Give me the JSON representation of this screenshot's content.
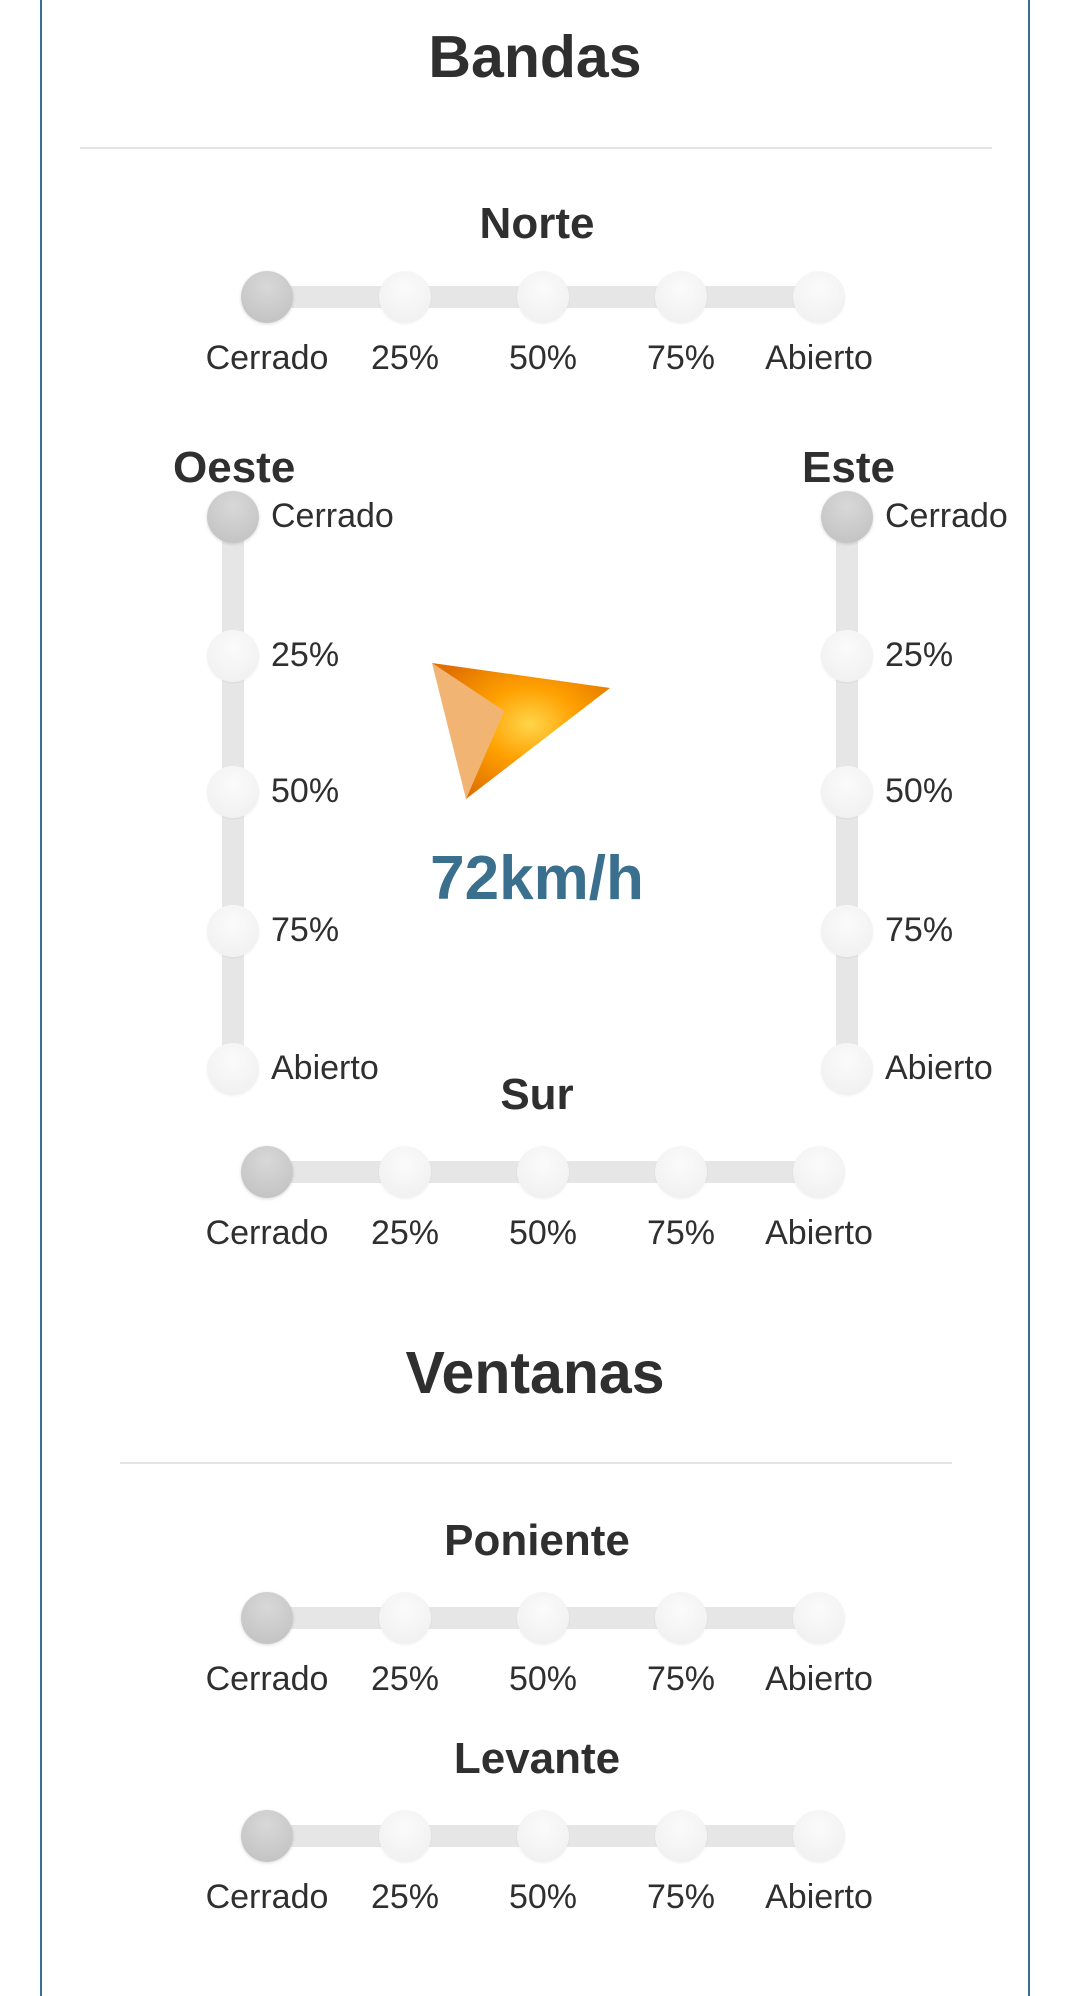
{
  "bandas": {
    "title": "Bandas",
    "norte": {
      "label": "Norte",
      "options": [
        "Cerrado",
        "25%",
        "50%",
        "75%",
        "Abierto"
      ],
      "selected": "Cerrado"
    },
    "oeste": {
      "label": "Oeste",
      "options": [
        "Cerrado",
        "25%",
        "50%",
        "75%",
        "Abierto"
      ],
      "selected": "Cerrado"
    },
    "este": {
      "label": "Este",
      "options": [
        "Cerrado",
        "25%",
        "50%",
        "75%",
        "Abierto"
      ],
      "selected": "Cerrado"
    },
    "sur": {
      "label": "Sur",
      "options": [
        "Cerrado",
        "25%",
        "50%",
        "75%",
        "Abierto"
      ],
      "selected": "Cerrado"
    }
  },
  "wind": {
    "speed": "72km/h",
    "icon": "wind-direction-arrow-icon",
    "arrow_color": "#ff8c00"
  },
  "ventanas": {
    "title": "Ventanas",
    "poniente": {
      "label": "Poniente",
      "options": [
        "Cerrado",
        "25%",
        "50%",
        "75%",
        "Abierto"
      ],
      "selected": "Cerrado"
    },
    "levante": {
      "label": "Levante",
      "options": [
        "Cerrado",
        "25%",
        "50%",
        "75%",
        "Abierto"
      ],
      "selected": "Cerrado"
    }
  },
  "colors": {
    "accent": "#3a6f8e",
    "border": "#3c6e91",
    "track": "#e6e6e6",
    "knob_active": "#c6c6c6"
  }
}
